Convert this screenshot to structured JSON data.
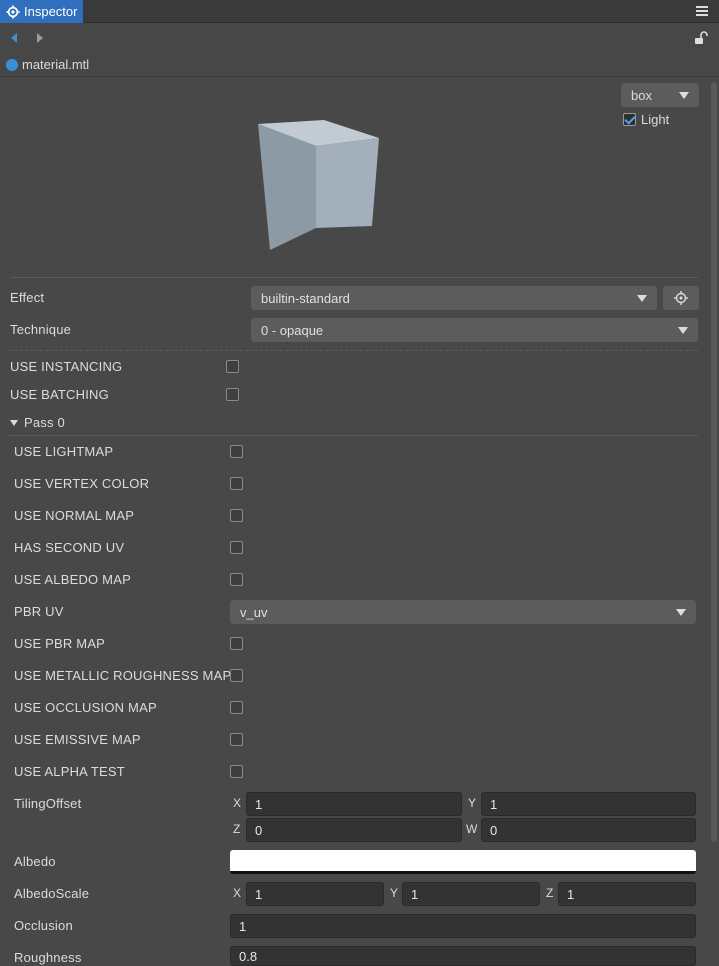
{
  "tab": {
    "title": "Inspector"
  },
  "file": {
    "name": "material.mtl"
  },
  "preview": {
    "shape": "box",
    "light_label": "Light",
    "light_checked": true
  },
  "effect": {
    "label": "Effect",
    "value": "builtin-standard"
  },
  "technique": {
    "label": "Technique",
    "value": "0 - opaque"
  },
  "global_defines": [
    {
      "label": "USE  INSTANCING",
      "checked": false
    },
    {
      "label": "USE  BATCHING",
      "checked": false
    }
  ],
  "pass": {
    "label": "Pass 0"
  },
  "pass_defines": [
    {
      "label": "USE  LIGHTMAP",
      "checked": false
    },
    {
      "label": "USE  VERTEX  COLOR",
      "checked": false
    },
    {
      "label": "USE  NORMAL  MAP",
      "checked": false
    },
    {
      "label": "HAS  SECOND  UV",
      "checked": false
    },
    {
      "label": "USE  ALBEDO  MAP",
      "checked": false
    }
  ],
  "pbr_uv": {
    "label": "PBR  UV",
    "value": "v_uv"
  },
  "pass_defines_2": [
    {
      "label": "USE  PBR  MAP",
      "checked": false
    },
    {
      "label": "USE  METALLIC  ROUGHNESS  MAP",
      "checked": false
    },
    {
      "label": "USE  OCCLUSION  MAP",
      "checked": false
    },
    {
      "label": "USE  EMISSIVE  MAP",
      "checked": false
    },
    {
      "label": "USE  ALPHA  TEST",
      "checked": false
    }
  ],
  "tiling_offset": {
    "label": "TilingOffset",
    "x": "1",
    "y": "1",
    "z": "0",
    "w": "0"
  },
  "albedo": {
    "label": "Albedo",
    "color": "#ffffff"
  },
  "albedo_scale": {
    "label": "AlbedoScale",
    "x": "1",
    "y": "1",
    "z": "1"
  },
  "occlusion": {
    "label": "Occlusion",
    "value": "1"
  },
  "roughness": {
    "label": "Roughness",
    "value": "0.8"
  },
  "axes": {
    "x": "X",
    "y": "Y",
    "z": "Z",
    "w": "W"
  },
  "colors": {
    "accent": "#2f6fbd",
    "panel": "#484848",
    "field": "#333333"
  }
}
